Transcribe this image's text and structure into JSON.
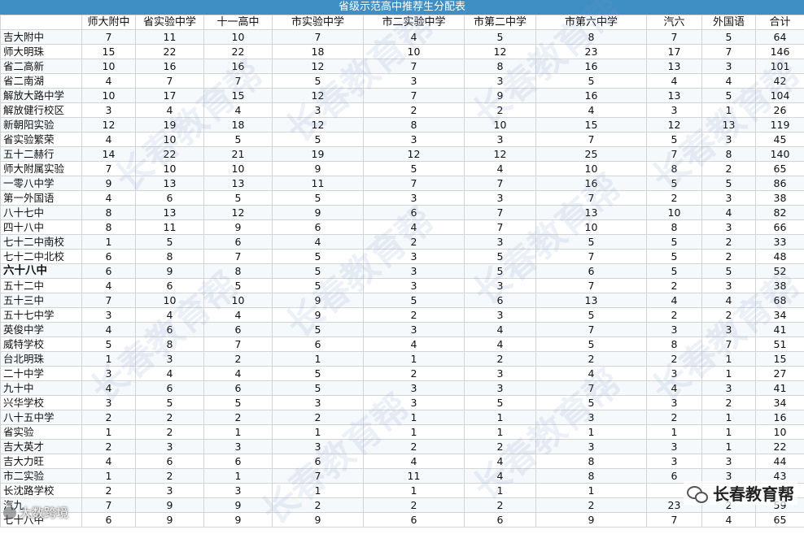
{
  "title": "省级示范高中推荐生分配表",
  "columns": [
    "",
    "师大附中",
    "省实验中学",
    "十一高中",
    "市实验中学",
    "市二实验中学",
    "市第二中学",
    "市第六中学",
    "汽六",
    "外国语",
    "合计"
  ],
  "rows": [
    [
      "吉大附中",
      "7",
      "11",
      "10",
      "7",
      "4",
      "5",
      "8",
      "7",
      "5",
      "64"
    ],
    [
      "师大明珠",
      "15",
      "22",
      "22",
      "18",
      "10",
      "12",
      "23",
      "17",
      "7",
      "146"
    ],
    [
      "省二高新",
      "10",
      "16",
      "16",
      "12",
      "7",
      "8",
      "16",
      "13",
      "3",
      "101"
    ],
    [
      "省二南湖",
      "4",
      "7",
      "7",
      "5",
      "3",
      "3",
      "5",
      "4",
      "4",
      "42"
    ],
    [
      "解放大路中学",
      "10",
      "17",
      "15",
      "12",
      "7",
      "9",
      "16",
      "13",
      "5",
      "104"
    ],
    [
      "解放健行校区",
      "3",
      "4",
      "4",
      "3",
      "2",
      "2",
      "4",
      "3",
      "1",
      "26"
    ],
    [
      "新朝阳实验",
      "12",
      "19",
      "18",
      "12",
      "8",
      "10",
      "15",
      "12",
      "13",
      "119"
    ],
    [
      "省实验繁荣",
      "4",
      "10",
      "5",
      "5",
      "3",
      "3",
      "7",
      "5",
      "3",
      "45"
    ],
    [
      "五十二赫行",
      "14",
      "22",
      "21",
      "19",
      "12",
      "12",
      "25",
      "7",
      "8",
      "140"
    ],
    [
      "师大附属实验",
      "7",
      "10",
      "10",
      "9",
      "5",
      "4",
      "10",
      "8",
      "2",
      "65"
    ],
    [
      "一零八中学",
      "9",
      "13",
      "13",
      "11",
      "7",
      "7",
      "16",
      "5",
      "5",
      "86"
    ],
    [
      "第一外国语",
      "4",
      "6",
      "5",
      "5",
      "3",
      "3",
      "7",
      "2",
      "3",
      "38"
    ],
    [
      "八十七中",
      "8",
      "13",
      "12",
      "9",
      "6",
      "7",
      "13",
      "10",
      "4",
      "82"
    ],
    [
      "四十八中",
      "8",
      "11",
      "9",
      "6",
      "4",
      "7",
      "10",
      "8",
      "3",
      "66"
    ],
    [
      "七十二中南校",
      "1",
      "5",
      "6",
      "4",
      "2",
      "3",
      "5",
      "5",
      "2",
      "33"
    ],
    [
      "七十二中北校",
      "6",
      "8",
      "7",
      "5",
      "3",
      "5",
      "7",
      "5",
      "2",
      "48"
    ],
    [
      "六十八中",
      "6",
      "9",
      "8",
      "5",
      "3",
      "5",
      "6",
      "5",
      "5",
      "52"
    ],
    [
      "五十二中",
      "4",
      "6",
      "5",
      "5",
      "3",
      "3",
      "7",
      "2",
      "3",
      "38"
    ],
    [
      "五十三中",
      "7",
      "10",
      "10",
      "9",
      "5",
      "6",
      "13",
      "4",
      "4",
      "68"
    ],
    [
      "五十七中学",
      "3",
      "4",
      "4",
      "9",
      "2",
      "3",
      "5",
      "2",
      "2",
      "34"
    ],
    [
      "英俊中学",
      "4",
      "6",
      "6",
      "5",
      "3",
      "4",
      "7",
      "3",
      "3",
      "41"
    ],
    [
      "威特学校",
      "5",
      "8",
      "7",
      "6",
      "4",
      "4",
      "5",
      "8",
      "7",
      "51"
    ],
    [
      "台北明珠",
      "1",
      "3",
      "2",
      "1",
      "1",
      "2",
      "2",
      "2",
      "1",
      "15"
    ],
    [
      "二十中学",
      "3",
      "4",
      "4",
      "5",
      "2",
      "3",
      "4",
      "3",
      "1",
      "27"
    ],
    [
      "九十中",
      "4",
      "6",
      "6",
      "5",
      "3",
      "3",
      "7",
      "4",
      "3",
      "41"
    ],
    [
      "兴华学校",
      "3",
      "5",
      "5",
      "3",
      "3",
      "5",
      "5",
      "3",
      "2",
      "34"
    ],
    [
      "八十五中学",
      "2",
      "2",
      "2",
      "2",
      "1",
      "1",
      "3",
      "2",
      "1",
      "16"
    ],
    [
      "省实验",
      "1",
      "2",
      "1",
      "1",
      "1",
      "1",
      "1",
      "1",
      "1",
      "10"
    ],
    [
      "吉大英才",
      "2",
      "3",
      "3",
      "3",
      "2",
      "2",
      "3",
      "3",
      "1",
      "22"
    ],
    [
      "吉大力旺",
      "4",
      "6",
      "6",
      "6",
      "4",
      "4",
      "8",
      "3",
      "3",
      "44"
    ],
    [
      "市二实验",
      "1",
      "2",
      "1",
      "7",
      "11",
      "4",
      "8",
      "6",
      "3",
      "43"
    ],
    [
      "长沈路学校",
      "2",
      "3",
      "3",
      "1",
      "1",
      "1",
      "1",
      "",
      "",
      ""
    ],
    [
      "汽九",
      "7",
      "9",
      "9",
      "2",
      "2",
      "2",
      "2",
      "23",
      "2",
      "59"
    ],
    [
      "七十八中",
      "6",
      "9",
      "9",
      "9",
      "6",
      "6",
      "9",
      "7",
      "4",
      "65"
    ]
  ],
  "bold_row_index": 16,
  "brand_text": "长春教育帮",
  "source_text": "大数跨境",
  "watermark_text": "长春教育帮",
  "colors": {
    "title_bg": "#3f8fc4",
    "title_fg": "#ffffff",
    "grid_line": "#d4d4d4"
  }
}
